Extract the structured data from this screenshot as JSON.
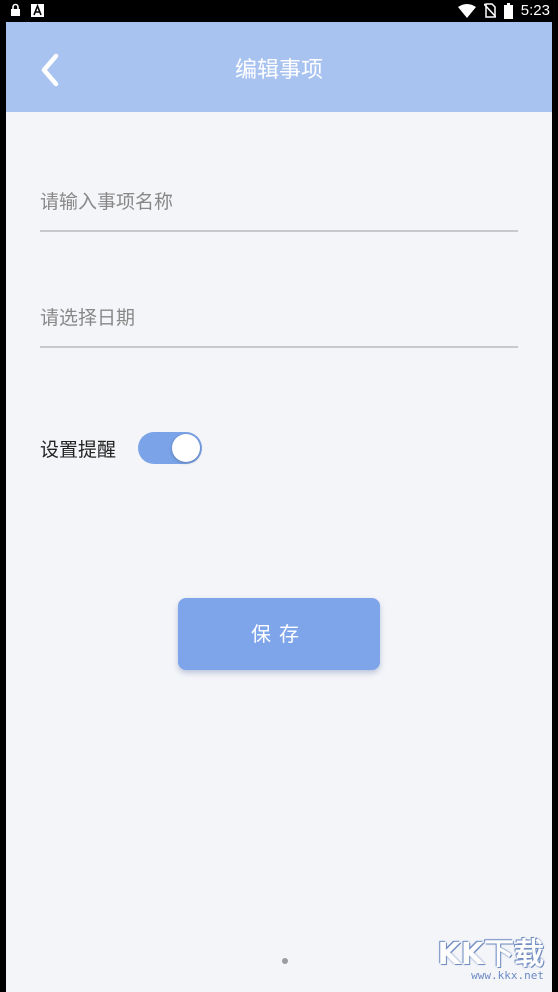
{
  "status_bar": {
    "time": "5:23",
    "icons": [
      "lock-icon",
      "a-icon",
      "wifi-icon",
      "no-sim-icon",
      "battery-icon"
    ]
  },
  "header": {
    "title": "编辑事项",
    "back_icon": "chevron-left-icon",
    "background": "#a9c3f1"
  },
  "form": {
    "name_placeholder": "请输入事项名称",
    "name_value": "",
    "date_placeholder": "请选择日期",
    "date_value": "",
    "reminder_label": "设置提醒",
    "reminder_on": true,
    "save_label": "保存"
  },
  "colors": {
    "accent": "#7ea4e9",
    "page_bg": "#f4f5f8"
  },
  "watermark": {
    "main": "KK下载",
    "sub": "www.kkx.net"
  }
}
